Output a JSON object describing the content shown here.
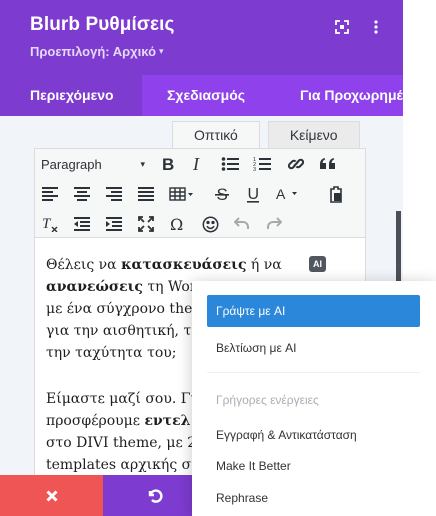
{
  "header": {
    "title": "Blurb Ρυθμίσεις",
    "preset_label": "Προεπιλογή: Αρχικό",
    "preset_caret": "▾"
  },
  "tabs": [
    {
      "label": "Περιεχόμενο",
      "active": true
    },
    {
      "label": "Σχεδιασμός",
      "active": false
    },
    {
      "label": "Για Προχωρημένους",
      "active": false
    }
  ],
  "editor": {
    "mode_tabs": [
      {
        "label": "Οπτικό",
        "active": true
      },
      {
        "label": "Κείμενο",
        "active": false
      }
    ],
    "format_select": {
      "value": "Paragraph",
      "caret": "▾"
    },
    "ai_badge": "AI",
    "paragraph1": {
      "l1a": "Θέλεις να ",
      "l1b": "κατασκευάσεις",
      "l1c": " ή να",
      "l2a": "ανανεώσεις",
      "l2b": " τη Wor",
      "l3": "με ένα σύγχρονο the",
      "l4": "για την αισθητική, τ",
      "l5": "την ταχύτητα του;"
    },
    "paragraph2": {
      "l1": "Είμαστε μαζί σου. Γι",
      "l2a": "προσφέρουμε ",
      "l2b": "εντελ",
      "l3": "στο DIVI theme, με 2",
      "l4": "templates αρχικής σ"
    }
  },
  "ai_menu": {
    "primary": "Γράψτε με AI",
    "secondary": "Βελτίωση με AI",
    "section_title": "Γρήγορες ενέργειες",
    "quick_actions": [
      "Εγγραφή & Αντικατάσταση",
      "Make It Better",
      "Rephrase"
    ]
  },
  "colors": {
    "header_purple": "#7e3bd0",
    "tabs_purple": "#8f42ec",
    "menu_highlight": "#2b87da",
    "cancel_red": "#ef5555",
    "redo_blue": "#0c9efe",
    "save_green": "#29c4a9"
  },
  "icons": {
    "header": [
      "expand-icon",
      "more-vertical-icon"
    ],
    "toolbar": [
      "bold-icon",
      "italic-icon",
      "bullet-list-icon",
      "numbered-list-icon",
      "link-icon",
      "blockquote-icon",
      "align-left-icon",
      "align-center-icon",
      "align-right-icon",
      "align-justify-icon",
      "table-icon",
      "strikethrough-icon",
      "underline-icon",
      "text-color-icon",
      "paste-icon",
      "clear-formatting-icon",
      "outdent-icon",
      "indent-icon",
      "fullscreen-icon",
      "special-character-icon",
      "emoji-icon",
      "undo-icon",
      "redo-icon"
    ],
    "footer": [
      "close-icon",
      "undo-icon",
      "redo-icon",
      "check-icon"
    ]
  }
}
